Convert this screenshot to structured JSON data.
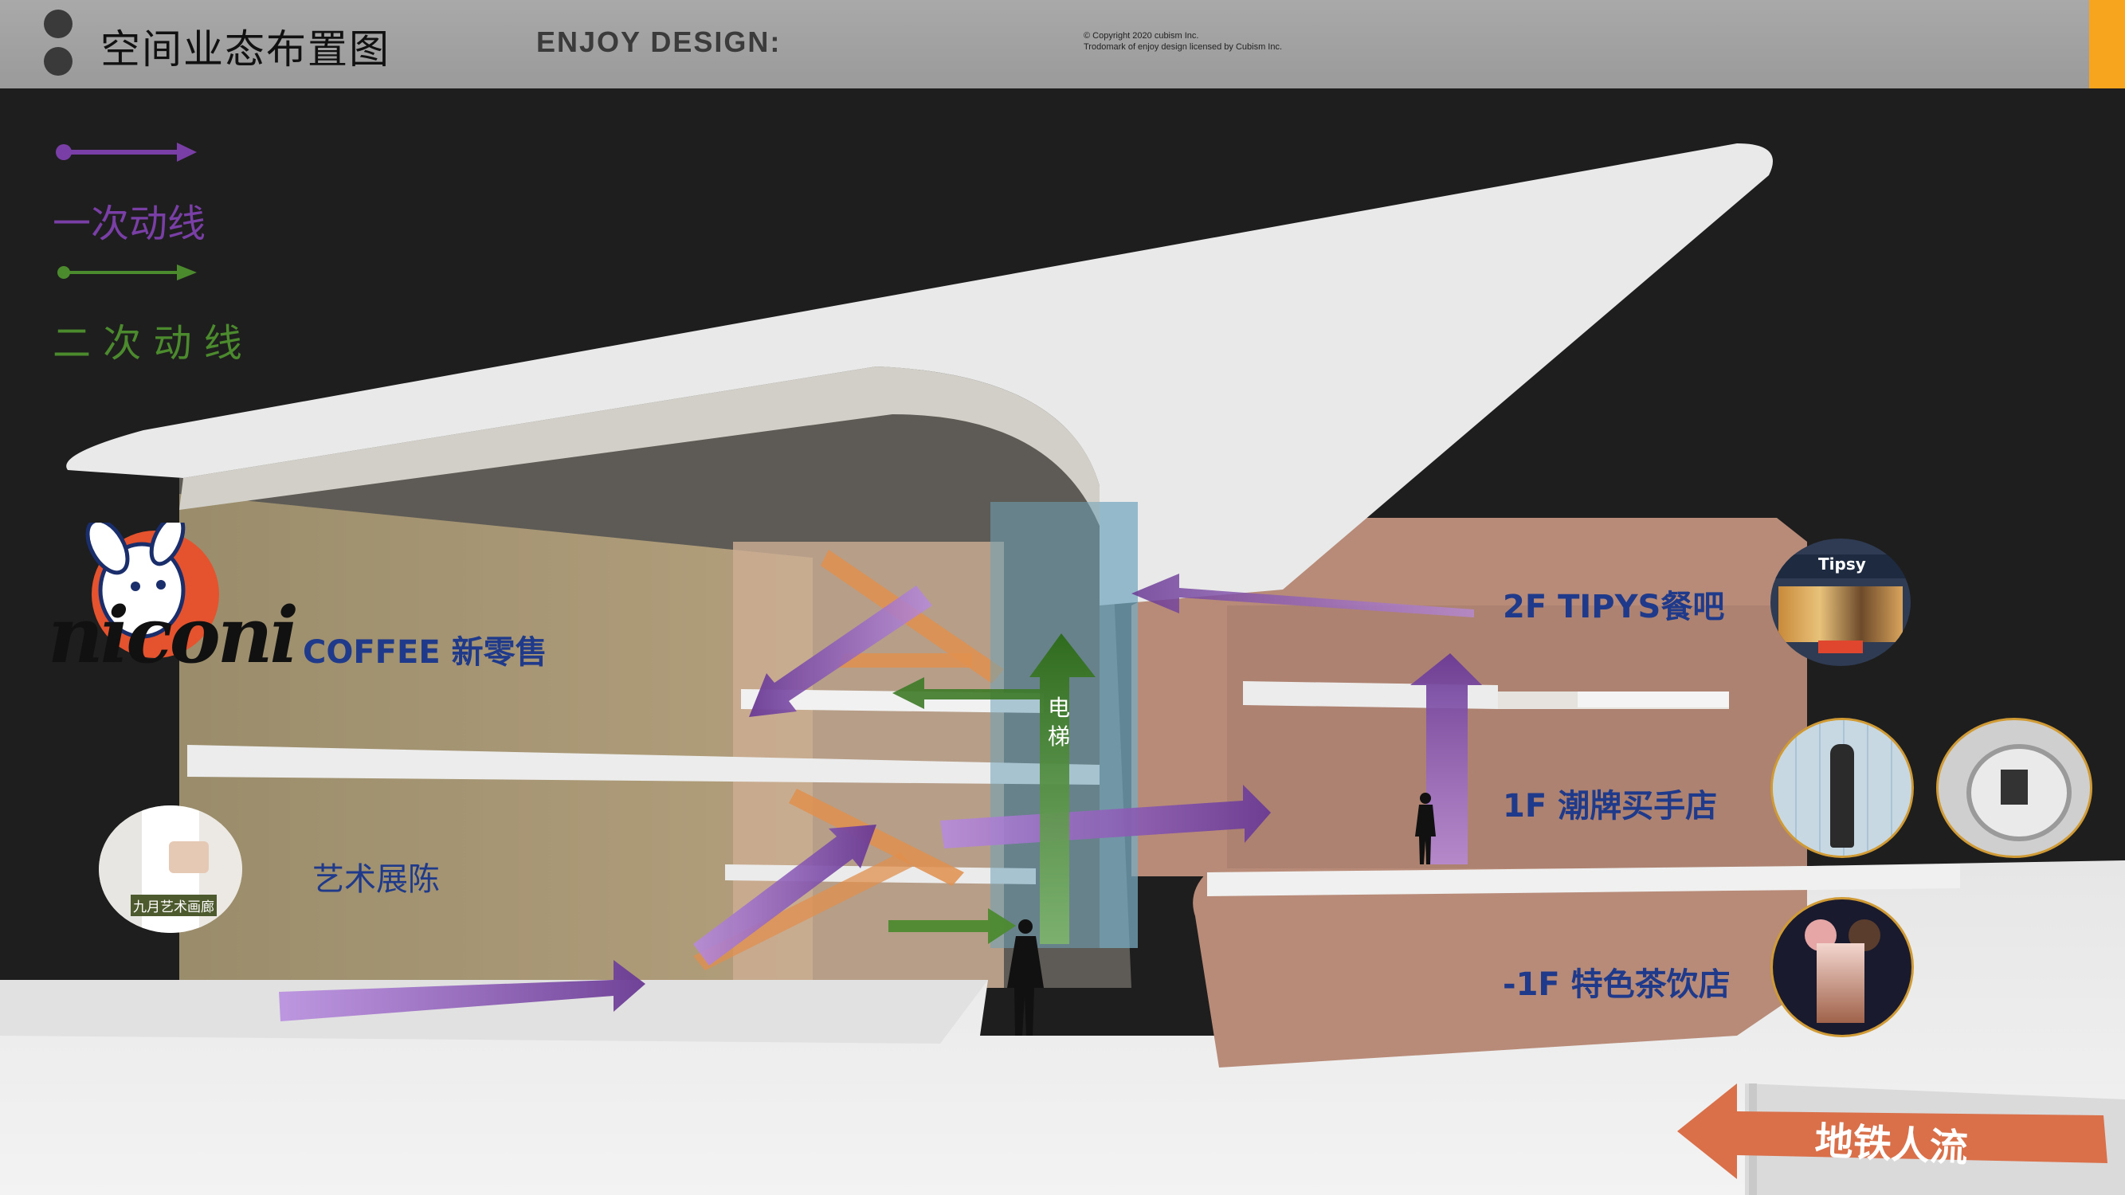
{
  "header": {
    "title": "空间业态布置图",
    "brand": "ENJOY DESIGN:",
    "copyright_line1": "©   Copyright 2020 cubism Inc.",
    "copyright_line2": "Trodomark of enjoy design licensed by Cubism Inc."
  },
  "legend": {
    "primary_label": "一次动线",
    "primary_color": "#7a3fa6",
    "secondary_label": "二 次 动 线",
    "secondary_color": "#4c8a2e"
  },
  "left_labels": {
    "logo_text": "niconi",
    "coffee": "COFFEE 新零售",
    "art": "艺术展陈",
    "art_photo_caption": "九月艺术画廊"
  },
  "elevator": {
    "char1": "电",
    "char2": "梯"
  },
  "right_labels": {
    "floor_2f": "2F TIPYS餐吧",
    "floor_1f": "1F 潮牌买手店",
    "floor_b1": "-1F 特色茶饮店",
    "tipsy_sign": "Tipsy"
  },
  "metro": {
    "label": "地铁人流",
    "color": "#d9704a"
  }
}
